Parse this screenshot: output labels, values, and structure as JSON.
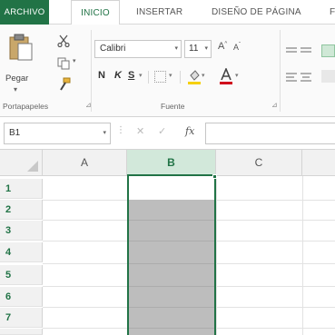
{
  "ribbon": {
    "tabs": [
      {
        "label": "ARCHIVO"
      },
      {
        "label": "INICIO"
      },
      {
        "label": "INSERTAR"
      },
      {
        "label": "DISEÑO DE PÁGINA"
      },
      {
        "label": "F"
      }
    ],
    "active_tab": "INICIO",
    "clipboard": {
      "paste_label": "Pegar",
      "group_label": "Portapapeles"
    },
    "font": {
      "font_name": "Calibri",
      "font_size": "11",
      "bold_label": "N",
      "italic_label": "K",
      "underline_label": "S",
      "group_label": "Fuente"
    },
    "icons": [
      "paste-icon",
      "cut-icon",
      "copy-icon",
      "format-painter-icon",
      "grow-font-icon",
      "shrink-font-icon",
      "borders-icon",
      "fill-color-icon",
      "font-color-icon",
      "align-icon",
      "wrap-text-icon"
    ],
    "accent_color": "#217346"
  },
  "formula_bar": {
    "name_box": "B1",
    "fx_label": "fx",
    "formula_value": ""
  },
  "grid": {
    "columns": [
      "A",
      "B",
      "C"
    ],
    "selected_column": "B",
    "rows": [
      "1",
      "2",
      "3",
      "4",
      "5",
      "6",
      "7"
    ],
    "active_cell": "B1"
  }
}
